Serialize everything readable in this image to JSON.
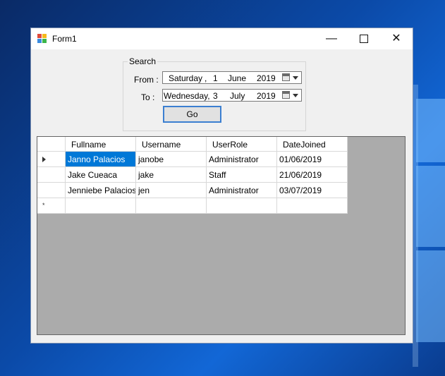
{
  "window": {
    "title": "Form1"
  },
  "search": {
    "group_label": "Search",
    "from_label": "From :",
    "to_label": "To :",
    "from": {
      "weekday": "Saturday",
      "sep1": ",",
      "day": "1",
      "month": "June",
      "year": "2019"
    },
    "to": {
      "weekday": "Wednesday,",
      "day": "3",
      "month": "July",
      "year": "2019"
    },
    "go_label": "Go"
  },
  "grid": {
    "columns": [
      "Fullname",
      "Username",
      "UserRole",
      "DateJoined"
    ],
    "rows": [
      [
        "Janno Palacios",
        "janobe",
        "Administrator",
        "01/06/2019"
      ],
      [
        "Jake Cueaca",
        "jake",
        "Staff",
        "21/06/2019"
      ],
      [
        "Jenniebe Palacios",
        "jen",
        "Administrator",
        "03/07/2019"
      ]
    ],
    "new_row_marker": "*"
  },
  "colors": {
    "selection": "#0078d7",
    "focus_border": "#3b7fd1",
    "grid_bg": "#ababab"
  }
}
